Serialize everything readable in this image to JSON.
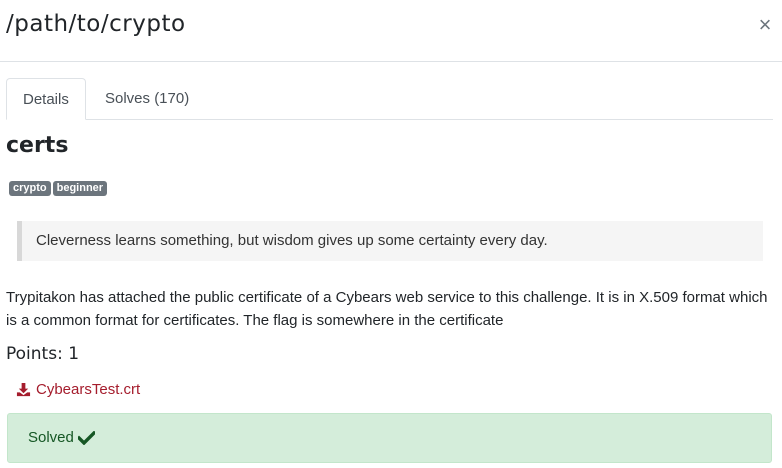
{
  "modal": {
    "title": "/path/to/crypto",
    "close_label": "×"
  },
  "tabs": [
    {
      "label": "Details",
      "active": true
    },
    {
      "label": "Solves (170)",
      "active": false
    }
  ],
  "challenge": {
    "name": "certs",
    "tags": [
      "crypto",
      "beginner"
    ],
    "quote": "Cleverness learns something, but wisdom gives up some certainty every day.",
    "description": "Trypitakon has attached the public certificate of a Cybears web service to this challenge. It is in X.509 format which is a common format for certificates. The flag is somewhere in the certificate",
    "points_text": "Points: 1",
    "file": {
      "name": "CybearsTest.crt",
      "icon": "download-icon"
    }
  },
  "status": {
    "text": "Solved",
    "icon": "check-icon"
  },
  "colors": {
    "tag_bg": "#6c757d",
    "link": "#a51d2d",
    "success_bg": "#d4edda",
    "success_text": "#155724"
  }
}
